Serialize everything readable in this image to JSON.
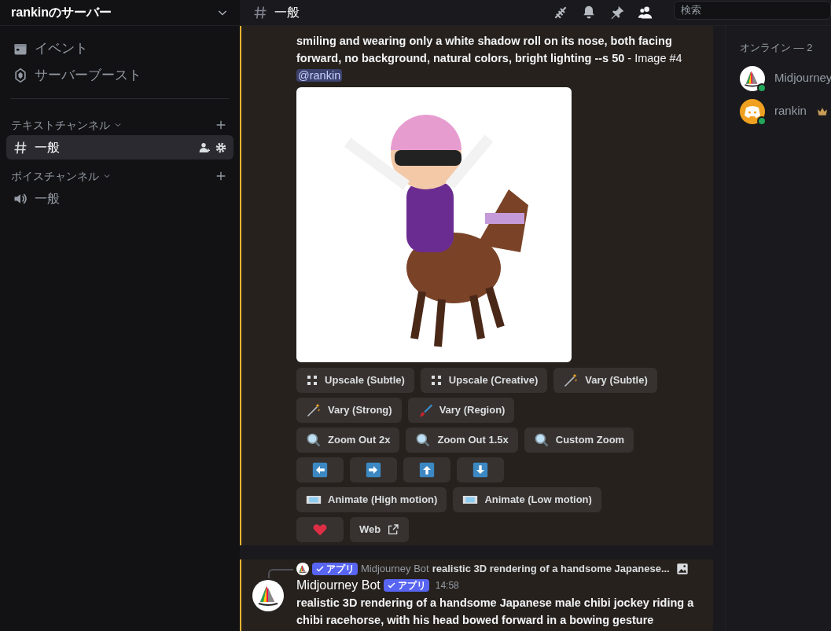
{
  "server": {
    "name": "rankinのサーバー"
  },
  "sidebar": {
    "shortcuts": [
      {
        "kind": "events",
        "label": "イベント"
      },
      {
        "kind": "boost",
        "label": "サーバーブースト"
      }
    ],
    "categories": [
      {
        "name": "テキストチャンネル",
        "channels": [
          {
            "kind": "text",
            "name": "一般",
            "selected": true
          }
        ]
      },
      {
        "name": "ボイスチャンネル",
        "channels": [
          {
            "kind": "voice",
            "name": "一般",
            "selected": false
          }
        ]
      }
    ]
  },
  "channel_header": {
    "name": "一般",
    "buttons": [
      {
        "kind": "threads",
        "selected": false
      },
      {
        "kind": "bell",
        "selected": false
      },
      {
        "kind": "pin",
        "selected": false
      },
      {
        "kind": "members",
        "selected": true
      }
    ]
  },
  "search": {
    "placeholder": "検索"
  },
  "messages": [
    {
      "highlighted": true,
      "text": "**smiling and wearing only a white shadow roll on its nose, both facing forward, no background, natural colors, bright lighting --s 50** - Image #4",
      "mention": "@rankin",
      "buttons": [
        [
          {
            "kind": "upscale",
            "label": "Upscale (Subtle)"
          },
          {
            "kind": "upscale",
            "label": "Upscale (Creative)"
          },
          {
            "kind": "wand",
            "label": "Vary (Subtle)"
          }
        ],
        [
          {
            "kind": "wand",
            "label": "Vary (Strong)"
          },
          {
            "kind": "brush",
            "label": "Vary (Region)"
          }
        ],
        [
          {
            "kind": "zoom",
            "label": "Zoom Out 2x"
          },
          {
            "kind": "zoom",
            "label": "Zoom Out 1.5x"
          },
          {
            "kind": "zoom",
            "label": "Custom Zoom"
          }
        ],
        [
          {
            "kind": "left"
          },
          {
            "kind": "right"
          },
          {
            "kind": "up"
          },
          {
            "kind": "down"
          }
        ],
        [
          {
            "kind": "film",
            "label": "Animate (High motion)"
          },
          {
            "kind": "film",
            "label": "Animate (Low motion)"
          }
        ],
        [
          {
            "kind": "heart"
          },
          {
            "kind": "link",
            "label": "Web"
          }
        ]
      ]
    },
    {
      "highlighted": true,
      "reply": {
        "badge": "アプリ",
        "author": "Midjourney Bot",
        "snippet": "realistic 3D rendering of a handsome Japanese..."
      },
      "author": "Midjourney Bot",
      "badge": "アプリ",
      "time": "14:58",
      "text": "**realistic 3D rendering of a handsome Japanese male chibi jockey riding a chibi racehorse, with his head bowed forward in a bowing gesture**"
    }
  ],
  "members": {
    "heading": "オンライン — 2",
    "list": [
      {
        "kind": "bot",
        "name": "Midjourney",
        "online": true,
        "owner": false
      },
      {
        "kind": "user",
        "name": "rankin",
        "online": true,
        "owner": true
      }
    ]
  }
}
